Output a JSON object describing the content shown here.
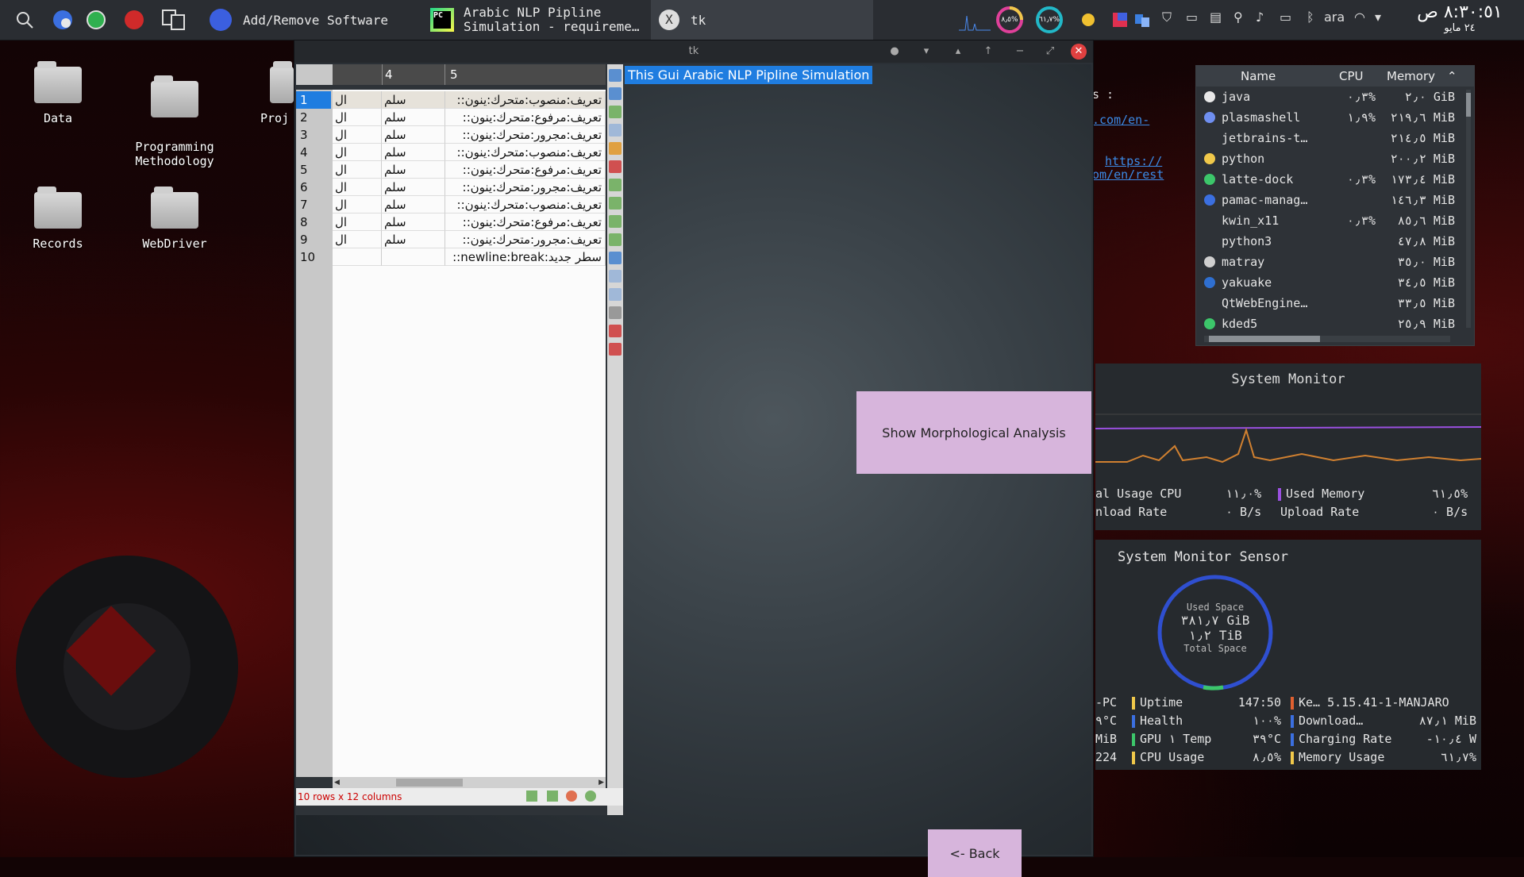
{
  "panel": {
    "tasks": [
      {
        "label": "Add/Remove Software"
      },
      {
        "line1": "Arabic NLP Pipline",
        "line2": "Simulation - requireme…"
      },
      {
        "label": "tk"
      }
    ],
    "tray": {
      "keyboard": "ara",
      "cpu_ring": "٨٫٥%",
      "ram_ring": "٦١٫٧%",
      "time": "٨:٣٠:٥١ ص",
      "date": "٢٤ مايو"
    }
  },
  "desktop": {
    "icons": [
      {
        "label": "Data"
      },
      {
        "label": "Programming\nMethodology"
      },
      {
        "label": "Proj"
      },
      {
        "label": "Records"
      },
      {
        "label": "WebDriver"
      }
    ]
  },
  "window": {
    "title": "tk",
    "heading": "This Gui Arabic NLP Pipline Simulation",
    "morph_button": "Show Morphological Analysis",
    "back_button": "<- Back",
    "table": {
      "col_headers": [
        "4",
        "5"
      ],
      "rows": [
        {
          "n": "1",
          "a": "ال",
          "b": "سلم",
          "c": "تعريف:منصوب:متحرك:ينون::"
        },
        {
          "n": "2",
          "a": "ال",
          "b": "سلم",
          "c": "تعريف:مرفوع:متحرك:ينون::"
        },
        {
          "n": "3",
          "a": "ال",
          "b": "سلم",
          "c": "تعريف:مجرور:متحرك:ينون::"
        },
        {
          "n": "4",
          "a": "ال",
          "b": "سلم",
          "c": "تعريف:منصوب:متحرك:ينون::"
        },
        {
          "n": "5",
          "a": "ال",
          "b": "سلم",
          "c": "تعريف:مرفوع:متحرك:ينون::"
        },
        {
          "n": "6",
          "a": "ال",
          "b": "سلم",
          "c": "تعريف:مجرور:متحرك:ينون::"
        },
        {
          "n": "7",
          "a": "ال",
          "b": "سلم",
          "c": "تعريف:منصوب:متحرك:ينون::"
        },
        {
          "n": "8",
          "a": "ال",
          "b": "سلم",
          "c": "تعريف:مرفوع:متحرك:ينون::"
        },
        {
          "n": "9",
          "a": "ال",
          "b": "سلم",
          "c": "تعريف:مجرور:متحرك:ينون::"
        },
        {
          "n": "10",
          "a": "",
          "b": "",
          "c": "سطر جديد:newline:break::"
        }
      ],
      "status": "10 rows x 12 columns"
    }
  },
  "behind_window": {
    "text1": "s :",
    "link1": ".com/en-",
    "link2a": "https://",
    "link2b": "om/en/rest"
  },
  "processes": {
    "headers": {
      "name": "Name",
      "cpu": "CPU",
      "memory": "Memory"
    },
    "rows": [
      {
        "name": "java",
        "cpu": "٠٫٣%",
        "mem": "٢٫٠ GiB",
        "color": "#e8e8e8"
      },
      {
        "name": "plasmashell",
        "cpu": "١٫٩%",
        "mem": "٢١٩٫٦ MiB",
        "color": "#6f8ff0"
      },
      {
        "name": "jetbrains-t…",
        "cpu": "",
        "mem": "٢١٤٫٥ MiB",
        "color": ""
      },
      {
        "name": "python",
        "cpu": "",
        "mem": "٢٠٠٫٢ MiB",
        "color": "#f0c84a"
      },
      {
        "name": "latte-dock",
        "cpu": "٠٫٣%",
        "mem": "١٧٣٫٤ MiB",
        "color": "#3cc66a"
      },
      {
        "name": "pamac-manag…",
        "cpu": "",
        "mem": "١٤٦٫٣ MiB",
        "color": "#3b6fe0"
      },
      {
        "name": "kwin_x11",
        "cpu": "٠٫٣%",
        "mem": "٨٥٫٦ MiB",
        "color": ""
      },
      {
        "name": "python3",
        "cpu": "",
        "mem": "٤٧٫٨ MiB",
        "color": ""
      },
      {
        "name": "matray",
        "cpu": "",
        "mem": "٣٥٫٠ MiB",
        "color": "#cfcfcf"
      },
      {
        "name": "yakuake",
        "cpu": "",
        "mem": "٣٤٫٥ MiB",
        "color": "#2f6fd0"
      },
      {
        "name": "QtWebEngine…",
        "cpu": "",
        "mem": "٣٣٫٥ MiB",
        "color": ""
      },
      {
        "name": "kded5",
        "cpu": "",
        "mem": "٢٥٫٩ MiB",
        "color": "#3cc66a"
      }
    ]
  },
  "monitor": {
    "title": "System Monitor",
    "cpu_label": "al Usage CPU",
    "cpu_value": "١١٫٠%",
    "mem_label": "Used Memory",
    "mem_value": "٦١٫٥%",
    "down_label": "nload Rate",
    "down_value": "٠ B/s",
    "up_label": "Upload Rate",
    "up_value": "٠ B/s"
  },
  "sensor": {
    "title": "System Monitor Sensor",
    "used_label": "Used Space",
    "used_value": "٣٨١٫٧ GiB",
    "total_value": "١٫٢ TiB",
    "total_label": "Total Space",
    "left_col": [
      "-PC",
      "٩°C",
      "MiB",
      "224"
    ],
    "mid": [
      {
        "label": "Uptime",
        "value": "147:50",
        "color": "#f0c84a"
      },
      {
        "label": "Health",
        "value": "١٠٠%",
        "color": "#3b6fe0"
      },
      {
        "label": "GPU ١ Temp",
        "value": "٣٩°C",
        "color": "#3cc66a"
      },
      {
        "label": "CPU Usage",
        "value": "٨٫٥%",
        "color": "#f0c84a"
      }
    ],
    "right": [
      {
        "label": "Ke… 5.15.41-1-MANJARO",
        "color": "#e06030"
      },
      {
        "label": "Download…",
        "value": "٨٧٫١ MiB",
        "color": "#3b6fe0"
      },
      {
        "label": "Charging Rate",
        "value": "-١٠٫٤ W",
        "color": "#3b6fe0"
      },
      {
        "label": "Memory Usage",
        "value": "٦١٫٧%",
        "color": "#f0c84a"
      }
    ]
  }
}
